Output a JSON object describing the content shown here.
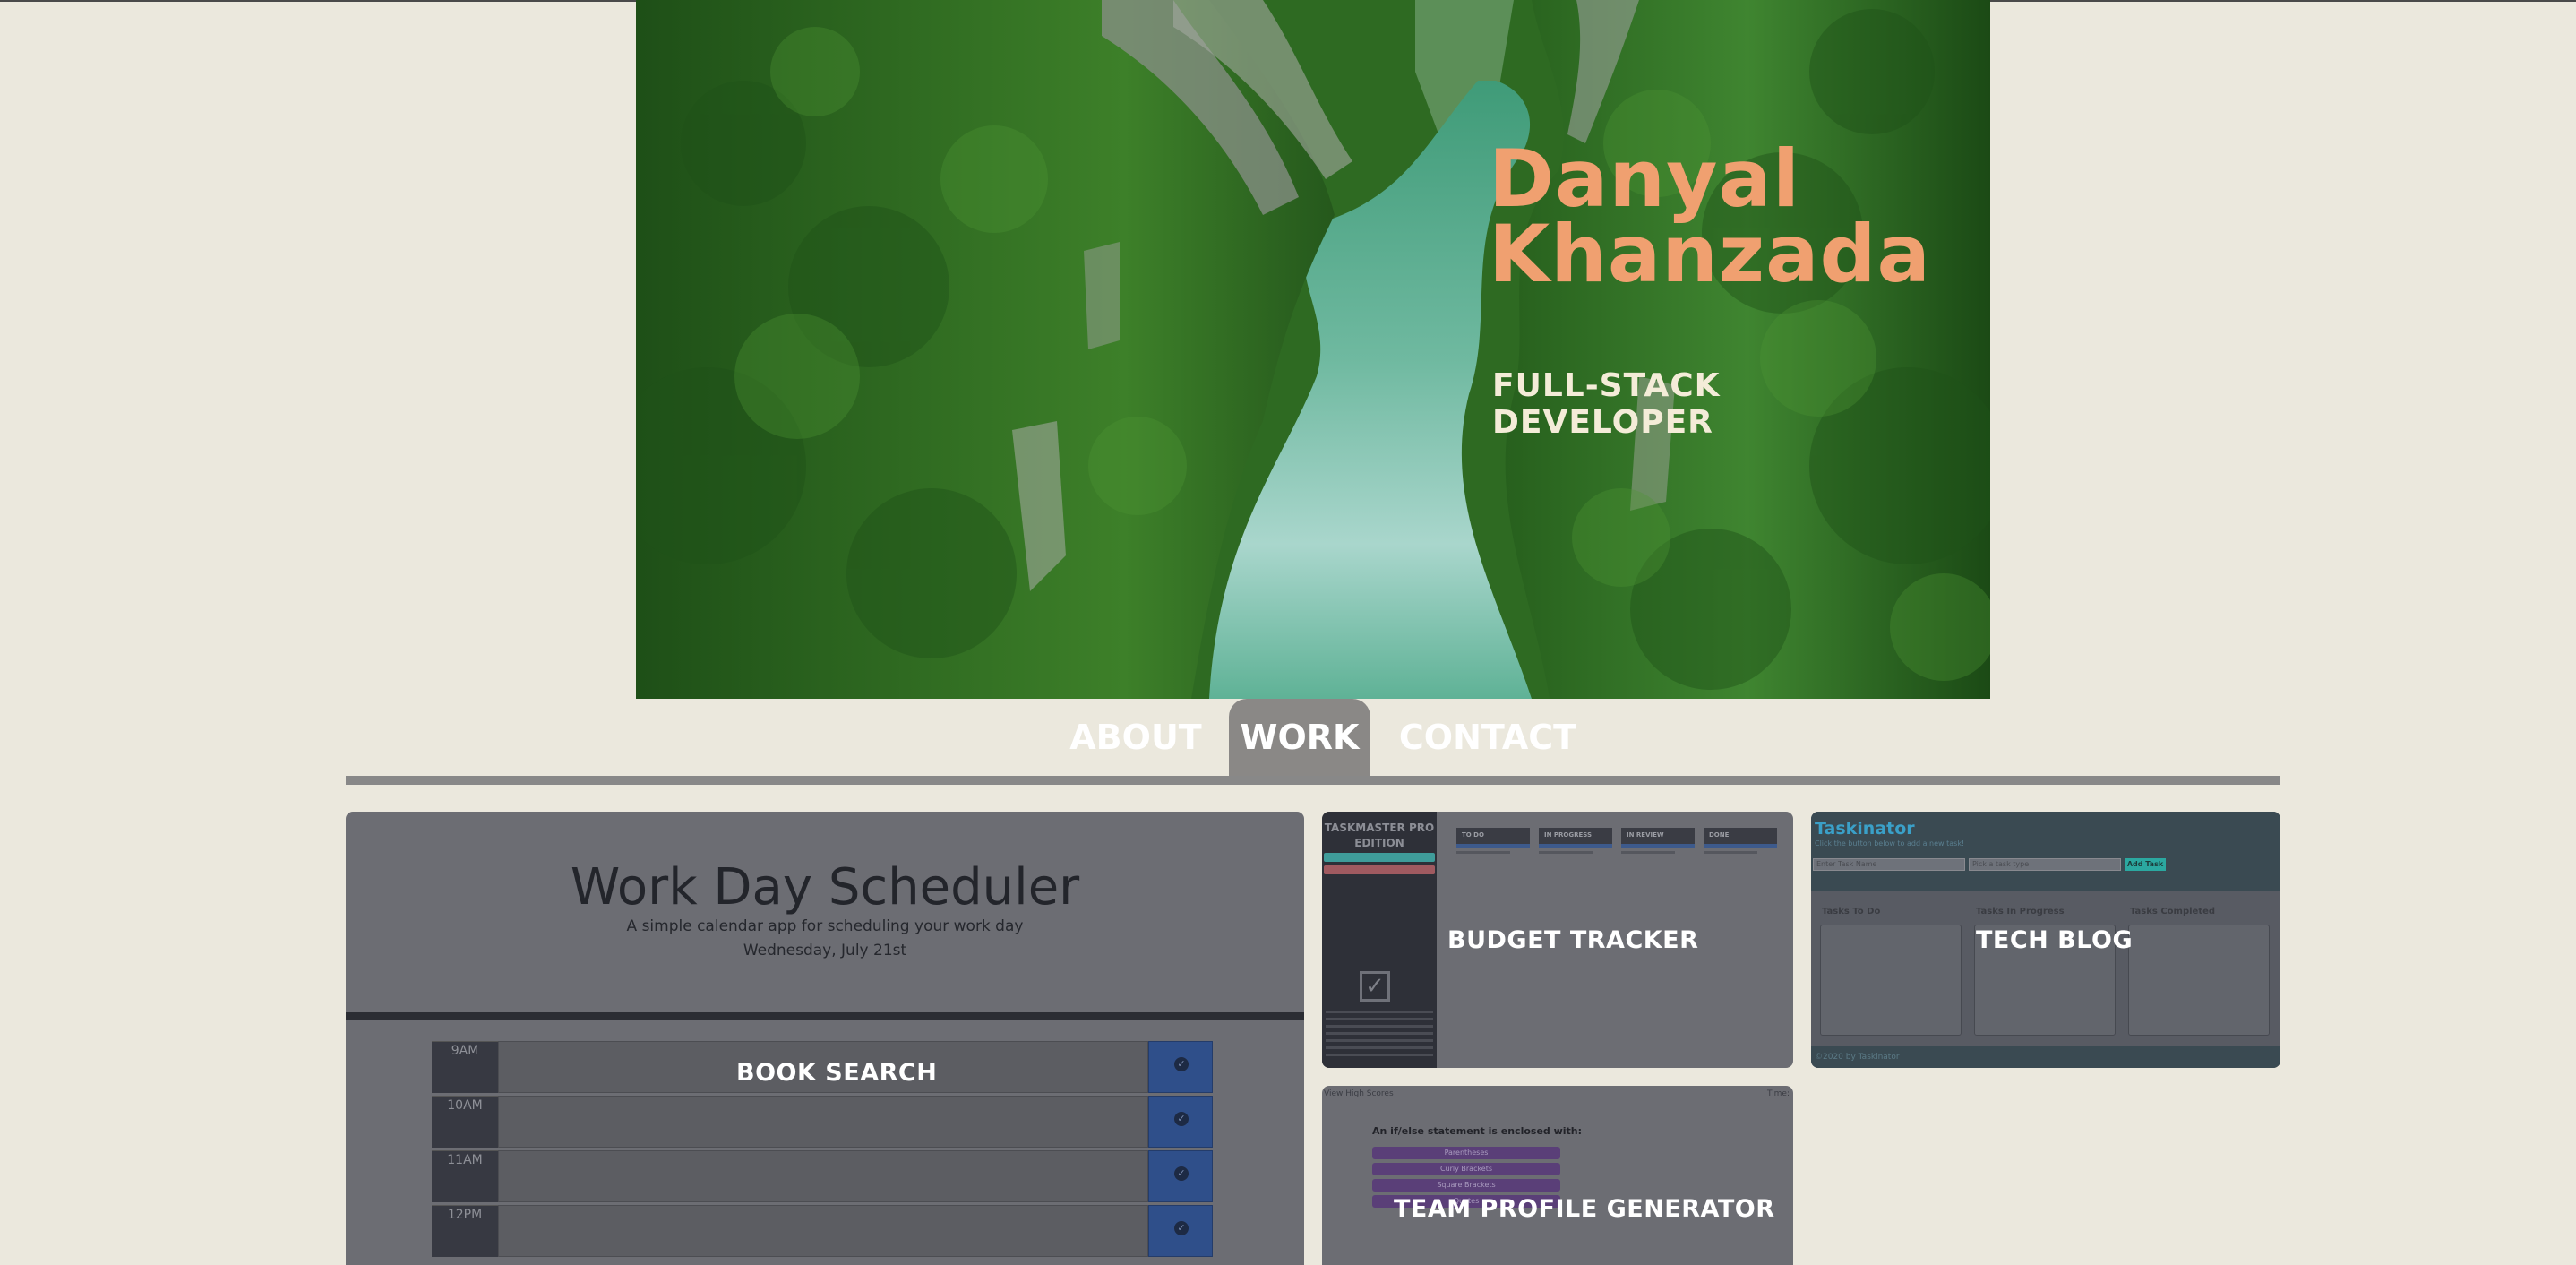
{
  "hero": {
    "name": "Danyal\nKhanzada",
    "role": "FULL-STACK\nDEVELOPER"
  },
  "nav": {
    "items": [
      {
        "label": "ABOUT",
        "active": false
      },
      {
        "label": "WORK",
        "active": true
      },
      {
        "label": "CONTACT",
        "active": false
      }
    ]
  },
  "projects": {
    "scheduler": {
      "label": "BOOK SEARCH",
      "preview_title": "Work Day Scheduler",
      "preview_subtitle": "A simple calendar app for scheduling your work day",
      "preview_date": "Wednesday, July 21st",
      "hours": [
        "9AM",
        "10AM",
        "11AM",
        "12PM"
      ]
    },
    "budget": {
      "label": "BUDGET TRACKER",
      "preview_side_title": "TASKMASTER PRO\nEDITION",
      "preview_columns": [
        "TO DO",
        "IN PROGRESS",
        "IN REVIEW",
        "DONE"
      ]
    },
    "techblog": {
      "label": "TECH BLOG",
      "preview_title": "Taskinator",
      "preview_tagline": "Click the button below to add a new task!",
      "preview_input_placeholder": "Enter Task Name",
      "preview_select_placeholder": "Pick a task type",
      "preview_button": "Add Task",
      "preview_columns": [
        "Tasks To Do",
        "Tasks In Progress",
        "Tasks Completed"
      ],
      "preview_footer": "©2020 by Taskinator"
    },
    "team": {
      "label": "TEAM PROFILE GENERATOR",
      "preview_left_small": "View High Scores",
      "preview_right_small": "Time:",
      "preview_question": "An if/else statement is enclosed with:",
      "preview_choices": [
        "Parentheses",
        "Curly Brackets",
        "Square Brackets",
        "Quotes"
      ]
    }
  },
  "colors": {
    "page_bg": "#ebe8dd",
    "hero_name": "#f0a070",
    "hero_role": "#f4ecd8",
    "nav_active_bg": "#8a8886",
    "card_overlay": "#6c6d73"
  }
}
